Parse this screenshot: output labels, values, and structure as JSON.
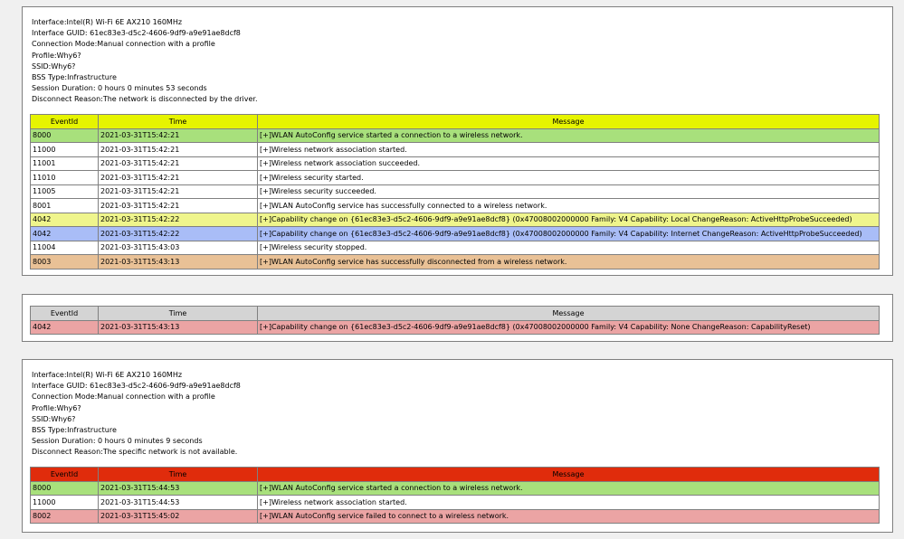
{
  "colors": {
    "header_yellow": "#e6f400",
    "header_gray": "#d4d4d4",
    "header_red": "#e02c0c",
    "row_green": "#a8e07c",
    "row_yellow": "#eff58c",
    "row_blue": "#a9bdf7",
    "row_tan": "#e9c196",
    "row_pink": "#eba4a4"
  },
  "columns": {
    "event_id": "EventId",
    "time": "Time",
    "message": "Message"
  },
  "session1": {
    "info": [
      "Interface:Intel(R) Wi-Fi 6E AX210 160MHz",
      "Interface GUID: 61ec83e3-d5c2-4606-9df9-a9e91ae8dcf8",
      "Connection Mode:Manual connection with a profile",
      "Profile:Why6?",
      "SSID:Why6?",
      "BSS Type:Infrastructure",
      "Session Duration: 0 hours 0 minutes 53 seconds",
      "Disconnect Reason:The network is disconnected by the driver."
    ],
    "rows": [
      {
        "id": "8000",
        "time": "2021-03-31T15:42:21",
        "message": "[+]WLAN AutoConfig service started a connection to a wireless network.",
        "color": "green"
      },
      {
        "id": "11000",
        "time": "2021-03-31T15:42:21",
        "message": "[+]Wireless network association started.",
        "color": "white"
      },
      {
        "id": "11001",
        "time": "2021-03-31T15:42:21",
        "message": "[+]Wireless network association succeeded.",
        "color": "white"
      },
      {
        "id": "11010",
        "time": "2021-03-31T15:42:21",
        "message": "[+]Wireless security started.",
        "color": "white"
      },
      {
        "id": "11005",
        "time": "2021-03-31T15:42:21",
        "message": "[+]Wireless security succeeded.",
        "color": "white"
      },
      {
        "id": "8001",
        "time": "2021-03-31T15:42:21",
        "message": "[+]WLAN AutoConfig service has successfully connected to a wireless network.",
        "color": "white"
      },
      {
        "id": "4042",
        "time": "2021-03-31T15:42:22",
        "message": "[+]Capability change on {61ec83e3-d5c2-4606-9df9-a9e91ae8dcf8} (0x47008002000000 Family: V4 Capability: Local ChangeReason: ActiveHttpProbeSucceeded)",
        "color": "yellow"
      },
      {
        "id": "4042",
        "time": "2021-03-31T15:42:22",
        "message": "[+]Capability change on {61ec83e3-d5c2-4606-9df9-a9e91ae8dcf8} (0x47008002000000 Family: V4 Capability: Internet ChangeReason: ActiveHttpProbeSucceeded)",
        "color": "blue"
      },
      {
        "id": "11004",
        "time": "2021-03-31T15:43:03",
        "message": "[+]Wireless security stopped.",
        "color": "white"
      },
      {
        "id": "8003",
        "time": "2021-03-31T15:43:13",
        "message": "[+]WLAN AutoConfig service has successfully disconnected from a wireless network.",
        "color": "tan"
      }
    ]
  },
  "session2": {
    "rows": [
      {
        "id": "4042",
        "time": "2021-03-31T15:43:13",
        "message": "[+]Capability change on {61ec83e3-d5c2-4606-9df9-a9e91ae8dcf8} (0x47008002000000 Family: V4 Capability: None ChangeReason: CapabilityReset)",
        "color": "pink"
      }
    ]
  },
  "session3": {
    "info": [
      "Interface:Intel(R) Wi-Fi 6E AX210 160MHz",
      "Interface GUID: 61ec83e3-d5c2-4606-9df9-a9e91ae8dcf8",
      "Connection Mode:Manual connection with a profile",
      "Profile:Why6?",
      "SSID:Why6?",
      "BSS Type:Infrastructure",
      "Session Duration: 0 hours 0 minutes 9 seconds",
      "Disconnect Reason:The specific network is not available."
    ],
    "rows": [
      {
        "id": "8000",
        "time": "2021-03-31T15:44:53",
        "message": "[+]WLAN AutoConfig service started a connection to a wireless network.",
        "color": "green"
      },
      {
        "id": "11000",
        "time": "2021-03-31T15:44:53",
        "message": "[+]Wireless network association started.",
        "color": "white"
      },
      {
        "id": "8002",
        "time": "2021-03-31T15:45:02",
        "message": "[+]WLAN AutoConfig service failed to connect to a wireless network.",
        "color": "pink"
      }
    ]
  }
}
